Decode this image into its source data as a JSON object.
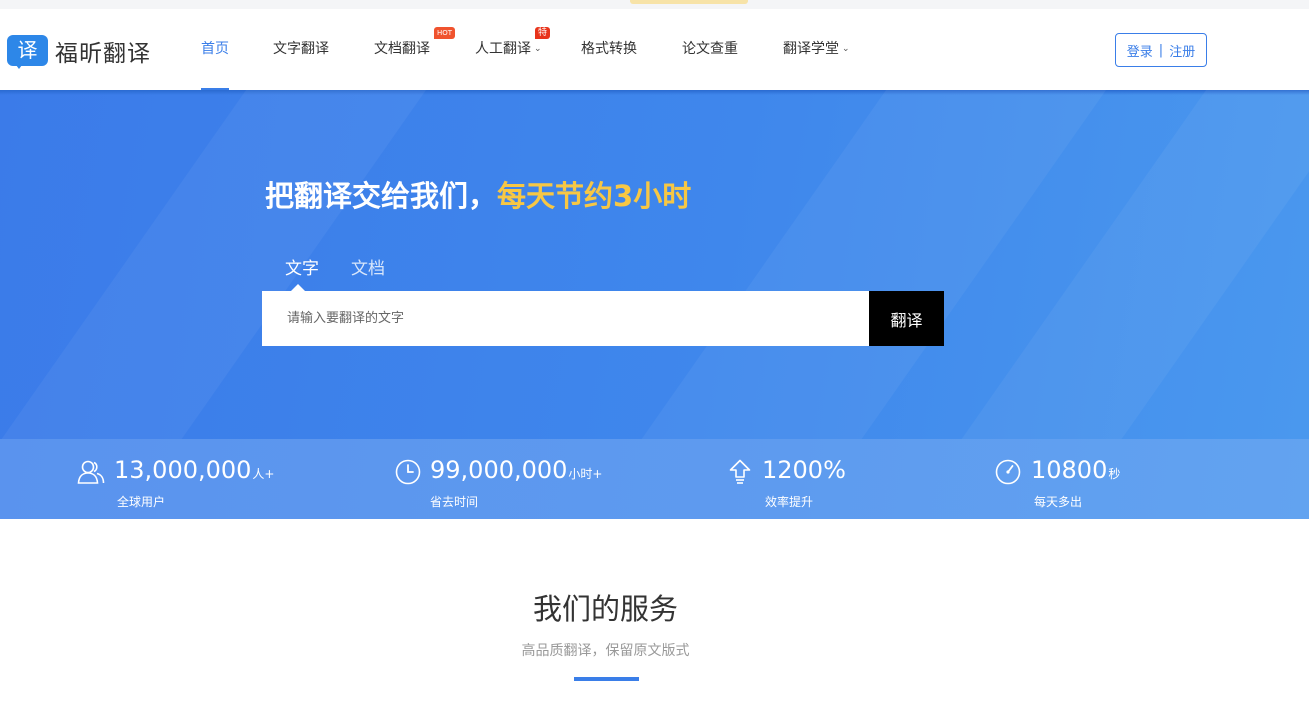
{
  "header": {
    "logo_glyph": "译",
    "logo_text": "福昕翻译",
    "nav": [
      {
        "label": "首页",
        "active": true
      },
      {
        "label": "文字翻译"
      },
      {
        "label": "文档翻译",
        "badge": "HOT"
      },
      {
        "label": "人工翻译",
        "badge": "特价",
        "has_dropdown": true
      },
      {
        "label": "格式转换"
      },
      {
        "label": "论文查重"
      },
      {
        "label": "翻译学堂",
        "has_dropdown": true
      }
    ],
    "login_label": "登录",
    "separator": "|",
    "register_label": "注册"
  },
  "hero": {
    "headline_main": "把翻译交给我们，",
    "headline_highlight": "每天节约3小时",
    "tabs": [
      {
        "label": "文字",
        "active": true
      },
      {
        "label": "文档",
        "active": false
      }
    ],
    "search_placeholder": "请输入要翻译的文字",
    "search_value": "",
    "translate_button": "翻译"
  },
  "stats": [
    {
      "icon": "users-icon",
      "value": "13,000,000",
      "unit": "人+",
      "label": "全球用户"
    },
    {
      "icon": "clock-icon",
      "value": "99,000,000",
      "unit": "小时+",
      "label": "省去时间"
    },
    {
      "icon": "upload-arrow-icon",
      "value": "1200%",
      "unit": "",
      "label": "效率提升"
    },
    {
      "icon": "stopwatch-icon",
      "value": "10800",
      "unit": "秒",
      "label": "每天多出"
    }
  ],
  "services": {
    "title": "我们的服务",
    "subtitle": "高品质翻译，保留原文版式"
  },
  "colors": {
    "accent": "#3a7ee8",
    "hero_bg": "#3b7be9",
    "highlight": "#f7c744",
    "badge_red": "#e8331a"
  }
}
